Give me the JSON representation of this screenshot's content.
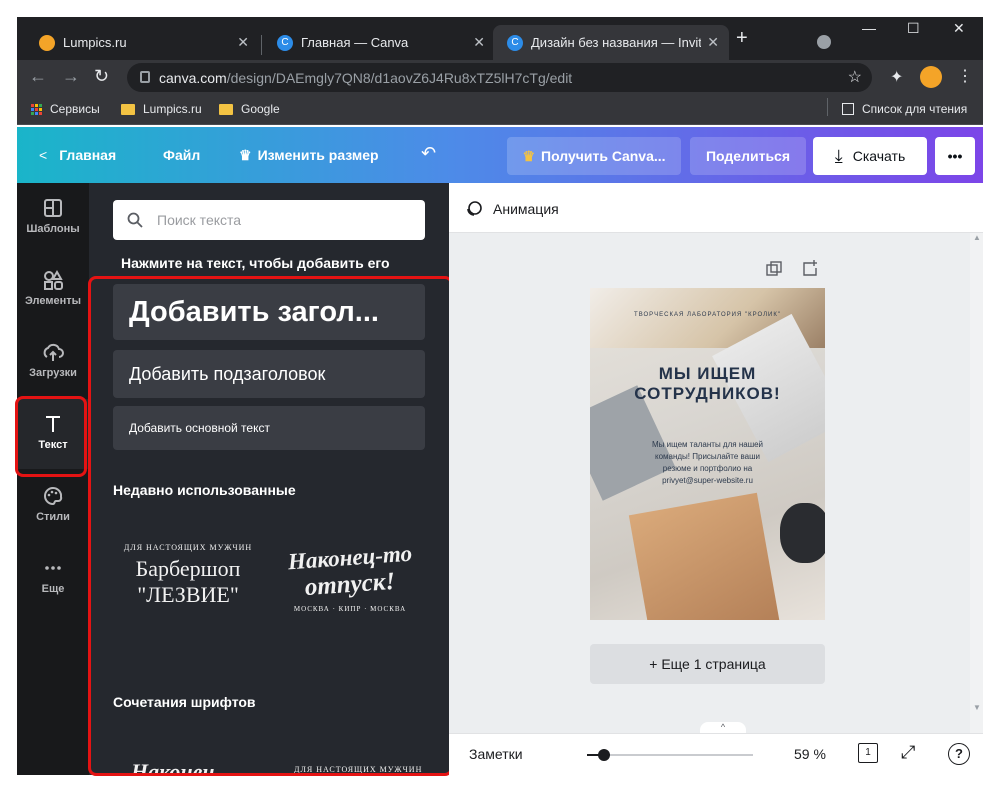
{
  "browser": {
    "tabs": [
      {
        "title": "Lumpics.ru",
        "favicon_color": "#f4a428",
        "active": false
      },
      {
        "title": "Главная — Canva",
        "favicon_color": "#2c8ce8",
        "active": false
      },
      {
        "title": "Дизайн без названия — Invitat",
        "favicon_color": "#2c8ce8",
        "active": true
      }
    ],
    "url_host": "canva.com",
    "url_path": "/design/DAEmgly7QN8/d1aovZ6J4Ru8xTZ5lH7cTg/edit",
    "bookmarks": [
      {
        "label": "Сервисы",
        "icon": "apps-grid-icon"
      },
      {
        "label": "Lumpics.ru",
        "icon": "folder-icon"
      },
      {
        "label": "Google",
        "icon": "folder-icon"
      }
    ],
    "reading_list": "Список для чтения"
  },
  "header": {
    "home": "Главная",
    "file": "Файл",
    "resize": "Изменить размер",
    "get_pro": "Получить Canva...",
    "share": "Поделиться",
    "download": "Скачать",
    "more": "•••"
  },
  "rail": [
    {
      "label": "Шаблоны",
      "icon": "templates-icon"
    },
    {
      "label": "Элементы",
      "icon": "elements-icon"
    },
    {
      "label": "Загрузки",
      "icon": "upload-icon"
    },
    {
      "label": "Текст",
      "icon": "text-icon"
    },
    {
      "label": "Стили",
      "icon": "palette-icon"
    },
    {
      "label": "Еще",
      "icon": "more-icon"
    }
  ],
  "panel": {
    "search_placeholder": "Поиск текста",
    "hint": "Нажмите на текст, чтобы добавить его",
    "heading": "Добавить загол...",
    "subheading": "Добавить подзаголовок",
    "body": "Добавить основной текст",
    "recent_title": "Недавно использованные",
    "recent": [
      {
        "small": "ДЛЯ НАСТОЯЩИХ МУЖЧИН",
        "line1": "Барбершоп",
        "line2": "\"ЛЕЗВИЕ\""
      },
      {
        "line1": "Наконец-то",
        "line2": "отпуск!",
        "small": "МОСКВА · КИПР · МОСКВА"
      }
    ],
    "combos_title": "Сочетания шрифтов",
    "combo_preview_right": "ДЛЯ НАСТОЯЩИХ МУЖЧИН"
  },
  "canvas": {
    "animation": "Анимация",
    "design": {
      "lab": "ТВОРЧЕСКАЯ ЛАБОРАТОРИЯ \"КРОЛИК\"",
      "title1": "МЫ ИЩЕМ",
      "title2": "СОТРУДНИКОВ!",
      "body1": "Мы ищем таланты для нашей",
      "body2": "команды! Присылайте ваши",
      "body3": "резюме и портфолио на",
      "body4": "privyet@super-website.ru"
    },
    "add_page": "+ Еще 1 страница"
  },
  "footer": {
    "notes": "Заметки",
    "zoom": "59 %",
    "zoom_fraction": 0.1,
    "page_count": "1"
  }
}
